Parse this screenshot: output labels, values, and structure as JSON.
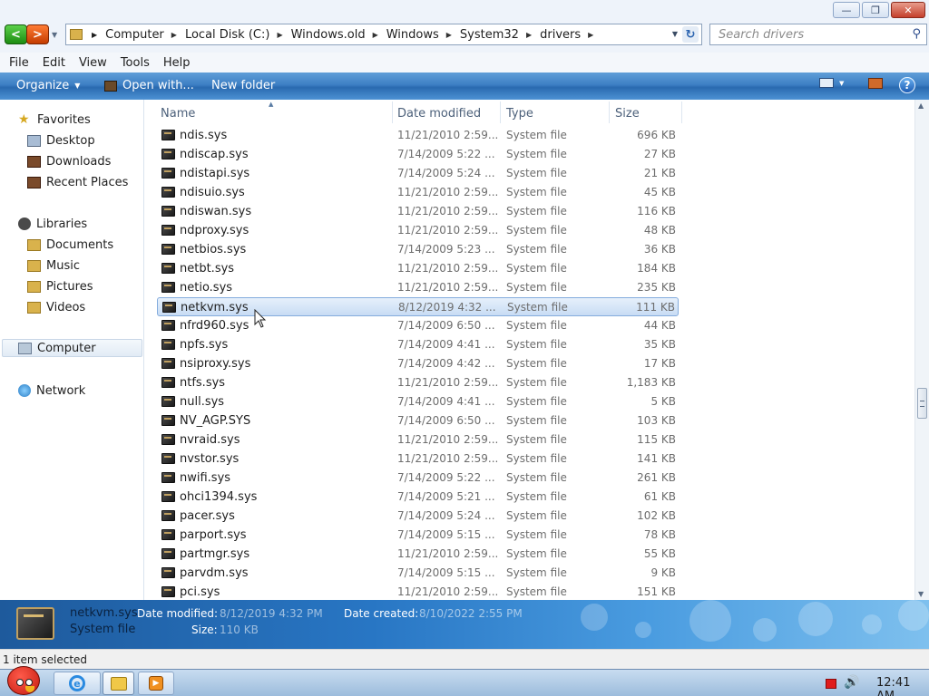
{
  "window": {
    "minimize_glyph": "—",
    "maximize_glyph": "❐",
    "close_glyph": "✕"
  },
  "navbar": {
    "back_glyph": "<",
    "forward_glyph": ">",
    "breadcrumbs": [
      "Computer",
      "Local Disk (C:)",
      "Windows.old",
      "Windows",
      "System32",
      "drivers"
    ],
    "search_placeholder": "Search drivers",
    "refresh_glyph": "↻",
    "search_glyph": "⚲"
  },
  "menu": {
    "items": [
      "File",
      "Edit",
      "View",
      "Tools",
      "Help"
    ]
  },
  "toolbar": {
    "organize_label": "Organize",
    "open_with_label": "Open with...",
    "new_folder_label": "New folder",
    "help_glyph": "?"
  },
  "sidebar": {
    "favorites": {
      "label": "Favorites",
      "items": [
        "Desktop",
        "Downloads",
        "Recent Places"
      ]
    },
    "libraries": {
      "label": "Libraries",
      "items": [
        "Documents",
        "Music",
        "Pictures",
        "Videos"
      ]
    },
    "computer_label": "Computer",
    "network_label": "Network"
  },
  "columns": [
    "Name",
    "Date modified",
    "Type",
    "Size"
  ],
  "files": [
    {
      "name": "ndis.sys",
      "date": "11/21/2010 2:59...",
      "type": "System file",
      "size": "696 KB"
    },
    {
      "name": "ndiscap.sys",
      "date": "7/14/2009 5:22 ...",
      "type": "System file",
      "size": "27 KB"
    },
    {
      "name": "ndistapi.sys",
      "date": "7/14/2009 5:24 ...",
      "type": "System file",
      "size": "21 KB"
    },
    {
      "name": "ndisuio.sys",
      "date": "11/21/2010 2:59...",
      "type": "System file",
      "size": "45 KB"
    },
    {
      "name": "ndiswan.sys",
      "date": "11/21/2010 2:59...",
      "type": "System file",
      "size": "116 KB"
    },
    {
      "name": "ndproxy.sys",
      "date": "11/21/2010 2:59...",
      "type": "System file",
      "size": "48 KB"
    },
    {
      "name": "netbios.sys",
      "date": "7/14/2009 5:23 ...",
      "type": "System file",
      "size": "36 KB"
    },
    {
      "name": "netbt.sys",
      "date": "11/21/2010 2:59...",
      "type": "System file",
      "size": "184 KB"
    },
    {
      "name": "netio.sys",
      "date": "11/21/2010 2:59...",
      "type": "System file",
      "size": "235 KB"
    },
    {
      "name": "netkvm.sys",
      "date": "8/12/2019 4:32 ...",
      "type": "System file",
      "size": "111 KB",
      "selected": true
    },
    {
      "name": "nfrd960.sys",
      "date": "7/14/2009 6:50 ...",
      "type": "System file",
      "size": "44 KB"
    },
    {
      "name": "npfs.sys",
      "date": "7/14/2009 4:41 ...",
      "type": "System file",
      "size": "35 KB"
    },
    {
      "name": "nsiproxy.sys",
      "date": "7/14/2009 4:42 ...",
      "type": "System file",
      "size": "17 KB"
    },
    {
      "name": "ntfs.sys",
      "date": "11/21/2010 2:59...",
      "type": "System file",
      "size": "1,183 KB"
    },
    {
      "name": "null.sys",
      "date": "7/14/2009 4:41 ...",
      "type": "System file",
      "size": "5 KB"
    },
    {
      "name": "NV_AGP.SYS",
      "date": "7/14/2009 6:50 ...",
      "type": "System file",
      "size": "103 KB"
    },
    {
      "name": "nvraid.sys",
      "date": "11/21/2010 2:59...",
      "type": "System file",
      "size": "115 KB"
    },
    {
      "name": "nvstor.sys",
      "date": "11/21/2010 2:59...",
      "type": "System file",
      "size": "141 KB"
    },
    {
      "name": "nwifi.sys",
      "date": "7/14/2009 5:22 ...",
      "type": "System file",
      "size": "261 KB"
    },
    {
      "name": "ohci1394.sys",
      "date": "7/14/2009 5:21 ...",
      "type": "System file",
      "size": "61 KB"
    },
    {
      "name": "pacer.sys",
      "date": "7/14/2009 5:24 ...",
      "type": "System file",
      "size": "102 KB"
    },
    {
      "name": "parport.sys",
      "date": "7/14/2009 5:15 ...",
      "type": "System file",
      "size": "78 KB"
    },
    {
      "name": "partmgr.sys",
      "date": "11/21/2010 2:59...",
      "type": "System file",
      "size": "55 KB"
    },
    {
      "name": "parvdm.sys",
      "date": "7/14/2009 5:15 ...",
      "type": "System file",
      "size": "9 KB"
    },
    {
      "name": "pci.sys",
      "date": "11/21/2010 2:59...",
      "type": "System file",
      "size": "151 KB"
    }
  ],
  "details": {
    "name": "netkvm.sys",
    "type": "System file",
    "date_modified_label": "Date modified:",
    "date_modified": "8/12/2019 4:32 PM",
    "size_label": "Size:",
    "size": "110 KB",
    "date_created_label": "Date created:",
    "date_created": "8/10/2022 2:55 PM"
  },
  "status": {
    "text": "1 item selected"
  },
  "taskbar": {
    "ie_glyph": "e",
    "wmp_glyph": "▶",
    "volume_glyph": "🔊",
    "clock": "12:41 AM"
  },
  "colors": {
    "selection": "#c8dcf4",
    "command_bar": "#3d7fc4",
    "details_pane": "#2876c4"
  }
}
